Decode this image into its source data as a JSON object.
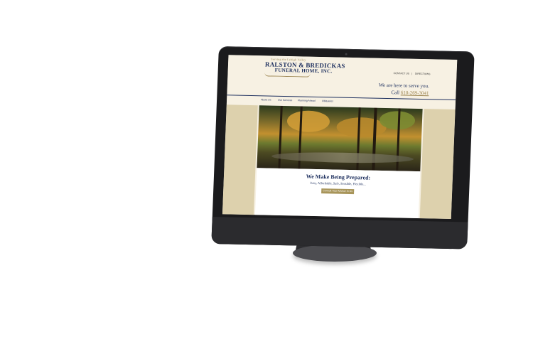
{
  "site": {
    "tagline": "Serving the Lehigh Valley",
    "logo_name": "RALSTON & BREDICKAS",
    "logo_sub": "FUNERAL HOME, INC.",
    "top_links": [
      "CONTACT US",
      "DIRECTIONS"
    ],
    "serve_text": "We are here to serve you.",
    "call_label": "Call",
    "phone": "610-269-3041",
    "nav": [
      "About Us",
      "Our Services",
      "Planning Ahead",
      "Obituaries"
    ],
    "promo_title": "We Make Being Prepared:",
    "promo_sub": "Easy, Affordable, Safe, Sensible, Flexible...",
    "promo_button": "Consult Your Advisor In Us"
  },
  "colors": {
    "navy": "#1d2f5e",
    "gold": "#9c8550",
    "cream": "#f7f1e3",
    "tan": "#ddd1ad",
    "device_body": "#1b1b1d"
  }
}
